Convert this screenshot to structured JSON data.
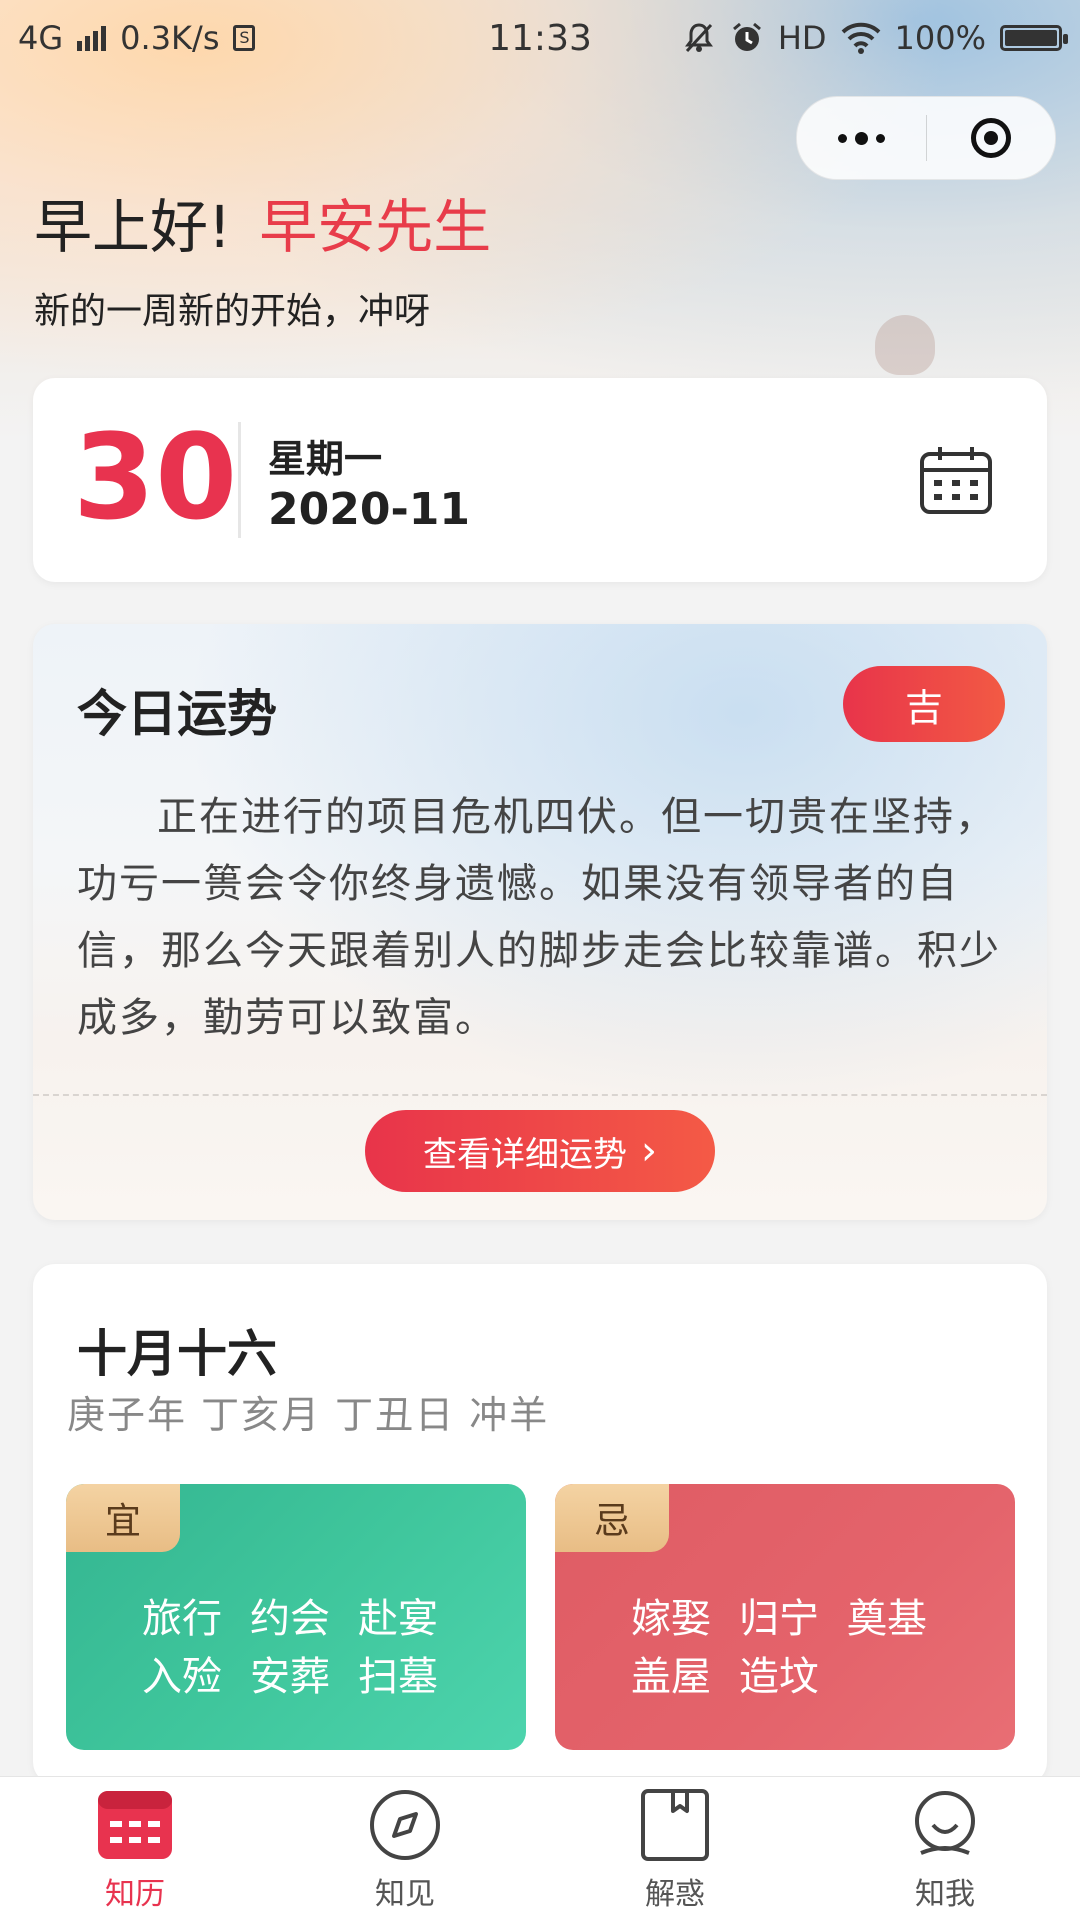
{
  "status_bar": {
    "network": "4G",
    "speed": "0.3K/s",
    "time": "11:33",
    "hd": "HD",
    "battery": "100%"
  },
  "greeting": {
    "hello": "早上好!",
    "name": "早安先生",
    "subtitle": "新的一周新的开始，冲呀"
  },
  "date_card": {
    "day": "30",
    "weekday": "星期一",
    "year_month": "2020-11"
  },
  "fortune": {
    "title": "今日运势",
    "badge": "吉",
    "text": "正在进行的项目危机四伏。但一切贵在坚持，功亏一篑会令你终身遗憾。如果没有领导者的自信，那么今天跟着别人的脚步走会比较靠谱。积少成多，勤劳可以致富。",
    "button_label": "查看详细运势",
    "button_arrow": "›"
  },
  "lunar": {
    "title": "十月十六",
    "ganzhi": "庚子年 丁亥月 丁丑日 冲羊",
    "yi": {
      "tag": "宜",
      "items": [
        "旅行",
        "约会",
        "赴宴",
        "入殓",
        "安葬",
        "扫墓"
      ]
    },
    "ji": {
      "tag": "忌",
      "items": [
        "嫁娶",
        "归宁",
        "奠基",
        "盖屋",
        "造坟"
      ]
    }
  },
  "tabs": [
    {
      "label": "知历",
      "icon": "calendar-tab-icon",
      "active": true
    },
    {
      "label": "知见",
      "icon": "compass-icon",
      "active": false
    },
    {
      "label": "解惑",
      "icon": "book-icon",
      "active": false
    },
    {
      "label": "知我",
      "icon": "user-icon",
      "active": false
    }
  ],
  "colors": {
    "accent": "#e8334f",
    "yi_green": "#3fc69c",
    "ji_red": "#e4636b",
    "tag_gold": "#e8bd85"
  }
}
